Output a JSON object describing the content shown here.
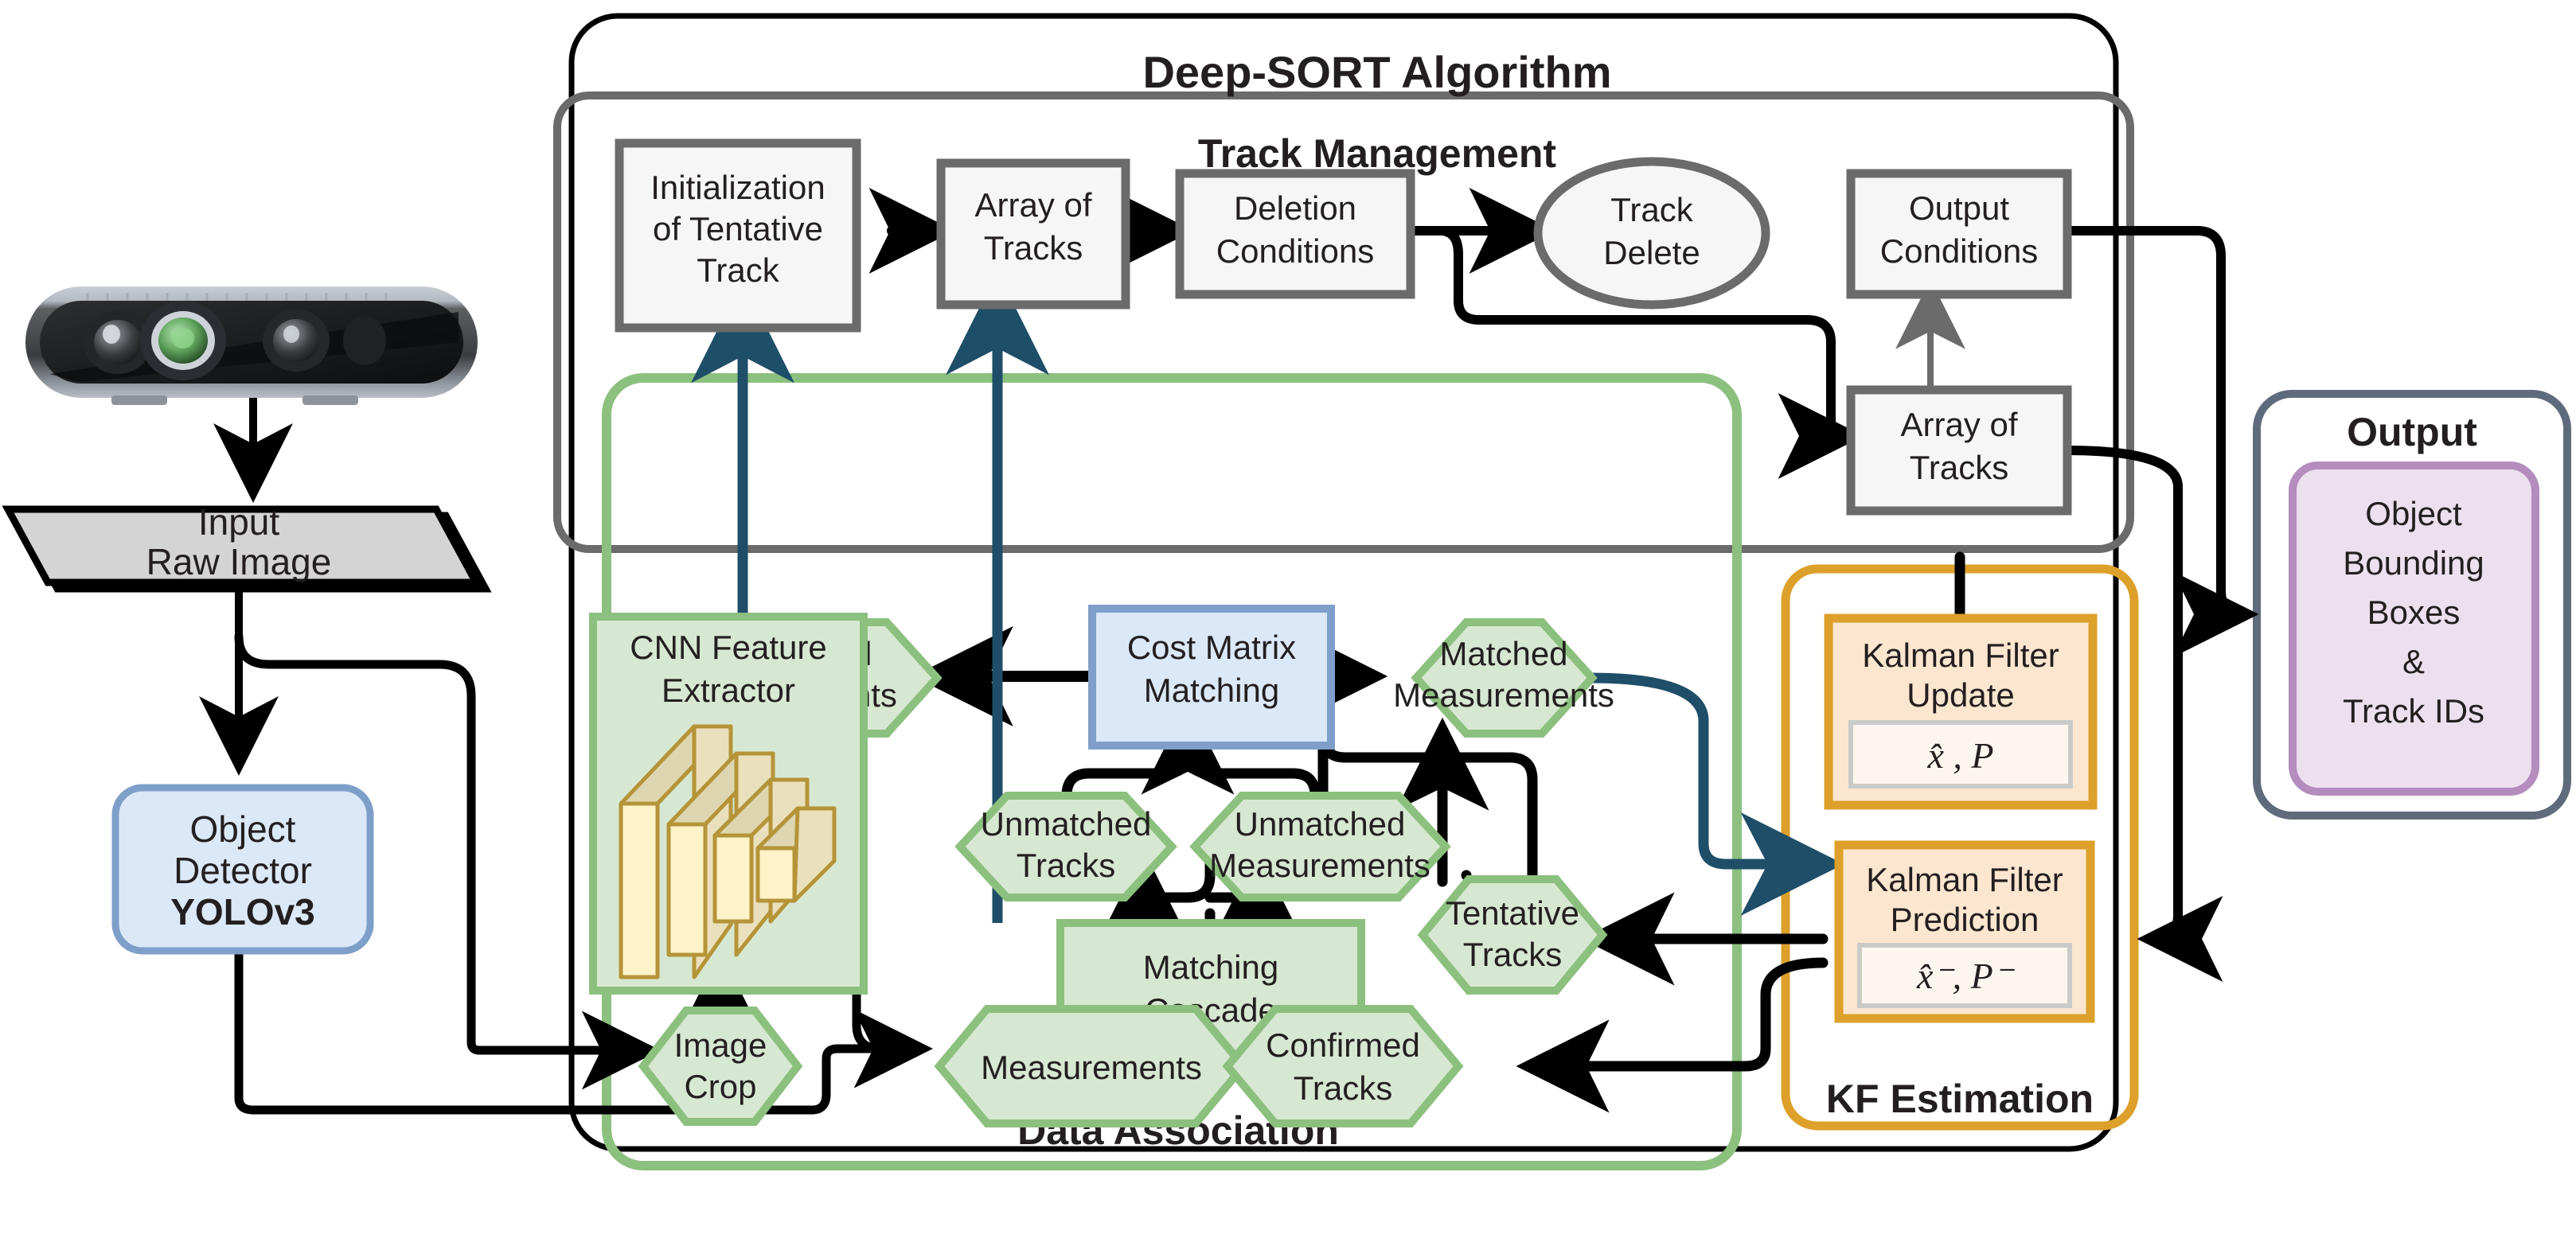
{
  "diagram": {
    "title": "Deep-SORT Algorithm",
    "sections": {
      "track_management": "Track Management",
      "data_association": "Data Association",
      "kf_estimation": "KF Estimation",
      "output": "Output"
    },
    "input_chain": {
      "camera_icon": "depth-camera-icon",
      "raw_image": "Input\nRaw Image",
      "raw_image_line1": "Input",
      "raw_image_line2": "Raw Image",
      "detector_line1": "Object",
      "detector_line2": "Detector",
      "detector_model": "YOLOv3"
    },
    "track_management_nodes": [
      {
        "id": "init-tentative-track",
        "lines": [
          "Initialization",
          "of Tentative",
          "Track"
        ]
      },
      {
        "id": "array-of-tracks-left",
        "lines": [
          "Array of",
          "Tracks"
        ]
      },
      {
        "id": "deletion-conditions",
        "lines": [
          "Deletion",
          "Conditions"
        ]
      },
      {
        "id": "track-delete",
        "lines": [
          "Track",
          "Delete"
        ]
      },
      {
        "id": "output-conditions",
        "lines": [
          "Output",
          "Conditions"
        ]
      },
      {
        "id": "array-of-tracks-right",
        "lines": [
          "Array of",
          "Tracks"
        ]
      }
    ],
    "data_association_nodes": [
      {
        "id": "unmatched-measurements-top",
        "lines": [
          "Unmatched",
          "Measurements"
        ]
      },
      {
        "id": "cost-matrix-matching",
        "lines": [
          "Cost Matrix",
          "Matching"
        ]
      },
      {
        "id": "matched-measurements",
        "lines": [
          "Matched",
          "Measurements"
        ]
      },
      {
        "id": "cnn-feature-extractor",
        "lines": [
          "CNN Feature",
          "Extractor"
        ]
      },
      {
        "id": "unmatched-tracks",
        "lines": [
          "Unmatched",
          "Tracks"
        ]
      },
      {
        "id": "unmatched-measurements-mid",
        "lines": [
          "Unmatched",
          "Measurements"
        ]
      },
      {
        "id": "matching-cascade",
        "lines": [
          "Matching",
          "Cascade"
        ]
      },
      {
        "id": "tentative-tracks",
        "lines": [
          "Tentative",
          "Tracks"
        ]
      },
      {
        "id": "image-crop",
        "lines": [
          "Image",
          "Crop"
        ]
      },
      {
        "id": "measurements",
        "lines": [
          "Measurements"
        ]
      },
      {
        "id": "confirmed-tracks",
        "lines": [
          "Confirmed",
          "Tracks"
        ]
      }
    ],
    "kf_nodes": [
      {
        "id": "kalman-filter-update",
        "lines": [
          "Kalman Filter",
          "Update"
        ],
        "state": "x̂ , P"
      },
      {
        "id": "kalman-filter-prediction",
        "lines": [
          "Kalman Filter",
          "Prediction"
        ],
        "state": "x̂⁻, P⁻"
      }
    ],
    "output_node": {
      "lines": [
        "Object",
        "Bounding",
        "Boxes",
        "&",
        "Track IDs"
      ]
    },
    "colors": {
      "green_fill": "#d7e8d2",
      "green_stroke": "#8cc07e",
      "blue_fill": "#dbe8f7",
      "blue_stroke": "#7e9fc9",
      "orange_fill": "#fce6cf",
      "orange_stroke": "#dda02a",
      "purple_fill": "#ece0ef",
      "purple_stroke": "#b48cbd",
      "gray_fill": "#f5f6f5",
      "gray_stroke": "#6b6b6b",
      "navy_arrow": "#1f4e68",
      "brown_arrow": "#b5651d",
      "slate_stroke": "#5f6b7d",
      "raw_image_fill": "#d4d4d4",
      "cnn_face": "#fdf2c8",
      "cnn_top": "#ded6b0",
      "cnn_edge": "#b59438",
      "black": "#000000"
    }
  }
}
